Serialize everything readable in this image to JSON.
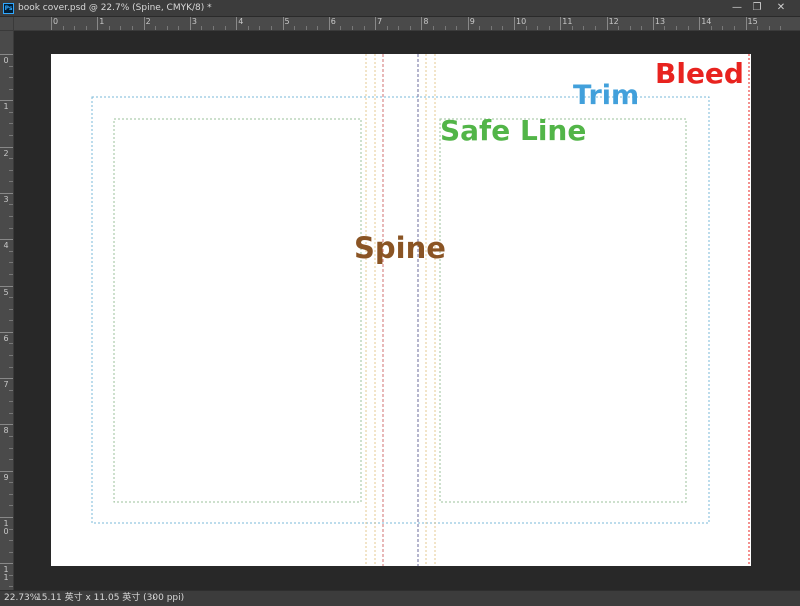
{
  "window": {
    "app_icon": "photoshop-icon",
    "tab_title": "book cover.psd @ 22.7% (Spine, CMYK/8) *",
    "minimize_glyph": "—",
    "maximize_glyph": "❐",
    "close_glyph": "✕"
  },
  "rulers": {
    "horizontal_labels": [
      "0",
      "1",
      "2",
      "3",
      "4",
      "5",
      "6",
      "7",
      "8",
      "9",
      "10",
      "11",
      "12",
      "13",
      "14",
      "15"
    ],
    "vertical_labels": [
      "0",
      "1",
      "2",
      "3",
      "4",
      "5",
      "6",
      "7",
      "8",
      "9",
      "10",
      "11"
    ]
  },
  "canvas": {
    "labels": {
      "bleed": "Bleed",
      "trim": "Trim",
      "safe_line": "Safe Line",
      "spine": "Spine"
    },
    "colors": {
      "bleed": "#e8231f",
      "trim": "#42a0db",
      "safe_line": "#52b548",
      "spine": "#8a5424",
      "safe_guide": "#9bc09b",
      "trim_guide": "#7ab8d8",
      "spine_guide": "#d07070",
      "fold_guide": "#e6c890"
    }
  },
  "status_bar": {
    "zoom": "22.73%",
    "document_info": "15.11 英寸 x 11.05 英寸 (300 ppi)",
    "info_arrow": "›"
  }
}
